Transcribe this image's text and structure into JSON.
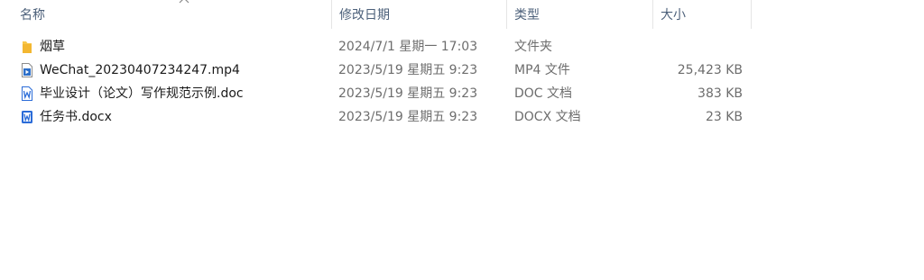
{
  "columns": {
    "name": "名称",
    "date": "修改日期",
    "type": "类型",
    "size": "大小"
  },
  "files": [
    {
      "name": "烟草",
      "date": "2024/7/1 星期一 17:03",
      "type": "文件夹",
      "size": "",
      "icon": "folder-icon"
    },
    {
      "name": "WeChat_20230407234247.mp4",
      "date": "2023/5/19 星期五 9:23",
      "type": "MP4 文件",
      "size": "25,423 KB",
      "icon": "video-file-icon"
    },
    {
      "name": "毕业设计（论文）写作规范示例.doc",
      "date": "2023/5/19 星期五 9:23",
      "type": "DOC 文档",
      "size": "383 KB",
      "icon": "word-doc-icon"
    },
    {
      "name": "任务书.docx",
      "date": "2023/5/19 星期五 9:23",
      "type": "DOCX 文档",
      "size": "23 KB",
      "icon": "word-doc-icon"
    }
  ],
  "colors": {
    "header_text": "#4c607a",
    "folder": "#f8c74a",
    "word": "#2b6cd8",
    "video": "#2d6fc9"
  }
}
